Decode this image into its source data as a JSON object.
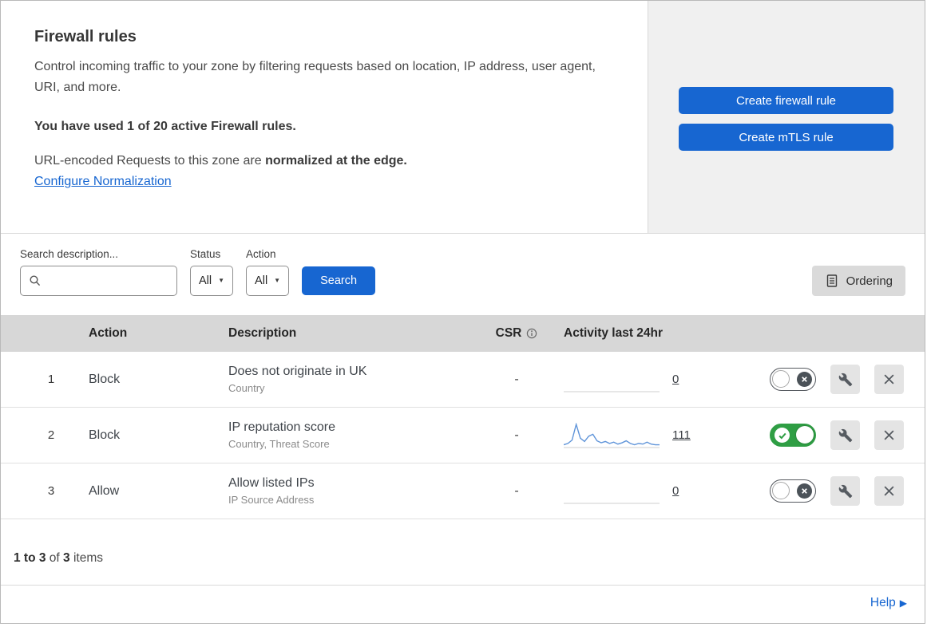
{
  "colors": {
    "accent": "#1766d1",
    "toggle_on": "#2f9e44",
    "sparkline": "#5f94d9"
  },
  "icons": {
    "caret_down": "▼",
    "help_arrow": "▶"
  },
  "header": {
    "title": "Firewall rules",
    "description": "Control incoming traffic to your zone by filtering requests based on location, IP address, user agent, URI, and more.",
    "usage_note": "You have used 1 of 20 active Firewall rules.",
    "normalization_text": "URL-encoded Requests to this zone are ",
    "normalization_bold": "normalized at the edge.",
    "normalization_link": "Configure Normalization",
    "buttons": [
      {
        "label": "Create firewall rule"
      },
      {
        "label": "Create mTLS rule"
      }
    ]
  },
  "filters": {
    "search_label": "Search description...",
    "status_label": "Status",
    "status_value": "All",
    "action_label": "Action",
    "action_value": "All",
    "search_button": "Search",
    "ordering_button": "Ordering"
  },
  "table": {
    "headers": {
      "action": "Action",
      "description": "Description",
      "csr": "CSR",
      "activity": "Activity last 24hr"
    },
    "rows": [
      {
        "num": "1",
        "action": "Block",
        "description": "Does not originate in UK",
        "criteria": "Country",
        "csr": "-",
        "activity_count": "0",
        "enabled": false,
        "activity_values": []
      },
      {
        "num": "2",
        "action": "Block",
        "description": "IP reputation score",
        "criteria": "Country, Threat Score",
        "csr": "-",
        "activity_count": "111",
        "enabled": true,
        "activity_values": [
          3,
          5,
          10,
          34,
          13,
          8,
          16,
          19,
          9,
          6,
          8,
          5,
          7,
          4,
          6,
          9,
          5,
          3,
          5,
          4,
          7,
          4,
          3,
          3
        ]
      },
      {
        "num": "3",
        "action": "Allow",
        "description": "Allow listed IPs",
        "criteria": "IP Source Address",
        "csr": "-",
        "activity_count": "0",
        "enabled": false,
        "activity_values": []
      }
    ]
  },
  "footer": {
    "range": "1 to 3",
    "of_text": " of ",
    "total": "3",
    "items_text": " items"
  },
  "help": {
    "label": "Help"
  }
}
